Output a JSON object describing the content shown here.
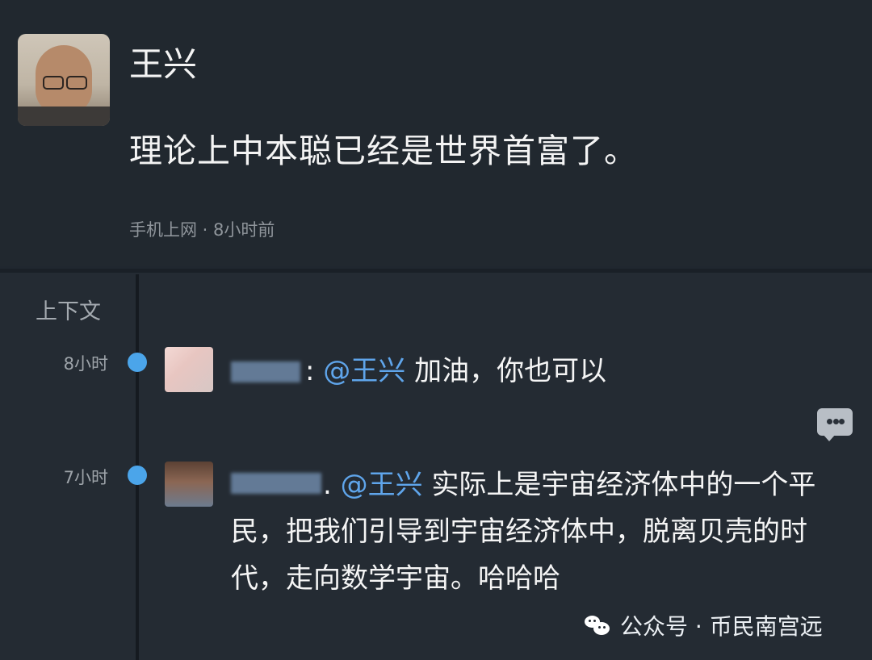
{
  "post": {
    "author": "王兴",
    "content": "理论上中本聪已经是世界首富了。",
    "meta": "手机上网 · 8小时前"
  },
  "context": {
    "label": "上下文",
    "comments": [
      {
        "time": "8小时",
        "mention": "@王兴",
        "separator": ":",
        "text": "加油，你也可以"
      },
      {
        "time": "7小时",
        "mention": "@王兴",
        "separator": ".",
        "text": "实际上是宇宙经济体中的一个平民，把我们引导到宇宙经济体中，脱离贝壳的时代，走向数学宇宙。哈哈哈"
      }
    ]
  },
  "watermark": {
    "text": "公众号 · 币民南宫远"
  },
  "icons": {
    "reply": "comment-icon",
    "wechat": "wechat-icon"
  },
  "colors": {
    "background": "#20272f",
    "timeline_dot": "#4ba5ea",
    "mention": "#5fa5eb"
  }
}
